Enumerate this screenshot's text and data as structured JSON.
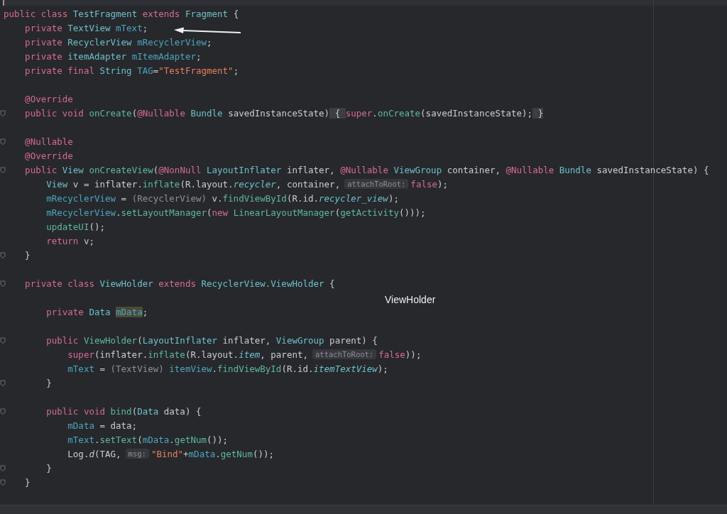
{
  "editor": {
    "lines": [
      {
        "fold": false,
        "segments": [
          {
            "kind": "code",
            "tokens": [
              {
                "text": "public class ",
                "kind": "kw"
              },
              {
                "text": "TestFragment ",
                "kind": "type"
              },
              {
                "text": "extends ",
                "kind": "kw"
              },
              {
                "text": "Fragment ",
                "kind": "type"
              },
              {
                "text": "{",
                "kind": "plain"
              }
            ]
          }
        ]
      },
      {
        "fold": false,
        "segments": [
          {
            "kind": "code",
            "tokens": [
              {
                "text": "    private ",
                "kind": "kw"
              },
              {
                "text": "TextView ",
                "kind": "type"
              },
              {
                "text": "mText",
                "kind": "field"
              },
              {
                "text": ";",
                "kind": "plain"
              }
            ]
          }
        ]
      },
      {
        "fold": false,
        "segments": [
          {
            "kind": "code",
            "tokens": [
              {
                "text": "    private ",
                "kind": "kw"
              },
              {
                "text": "RecyclerView ",
                "kind": "type"
              },
              {
                "text": "mRecyclerView",
                "kind": "field"
              },
              {
                "text": ";",
                "kind": "plain"
              }
            ]
          }
        ]
      },
      {
        "fold": false,
        "segments": [
          {
            "kind": "code",
            "tokens": [
              {
                "text": "    private ",
                "kind": "kw"
              },
              {
                "text": "itemAdapter ",
                "kind": "type"
              },
              {
                "text": "mItemAdapter",
                "kind": "field"
              },
              {
                "text": ";",
                "kind": "plain"
              }
            ]
          }
        ]
      },
      {
        "fold": false,
        "segments": [
          {
            "kind": "code",
            "tokens": [
              {
                "text": "    private final ",
                "kind": "kw"
              },
              {
                "text": "String ",
                "kind": "type"
              },
              {
                "text": "TAG",
                "kind": "field"
              },
              {
                "text": "=",
                "kind": "plain"
              },
              {
                "text": "\"TestFragment\"",
                "kind": "string"
              },
              {
                "text": ";",
                "kind": "plain"
              }
            ]
          }
        ]
      },
      {
        "fold": false
      },
      {
        "fold": false,
        "segments": [
          {
            "kind": "code",
            "tokens": [
              {
                "text": "    @Override",
                "kind": "annotation"
              }
            ]
          }
        ]
      },
      {
        "fold": true,
        "segments": [
          {
            "kind": "code",
            "tokens": [
              {
                "text": "    public void ",
                "kind": "kw"
              },
              {
                "text": "onCreate",
                "kind": "method"
              },
              {
                "text": "(",
                "kind": "plain"
              },
              {
                "text": "@Nullable ",
                "kind": "annotation"
              },
              {
                "text": "Bundle ",
                "kind": "type"
              },
              {
                "text": "savedInstanceState)",
                "kind": "plain"
              },
              {
                "text": " { ",
                "kind": "folded"
              },
              {
                "text": "super",
                "kind": "kw"
              },
              {
                "text": ".",
                "kind": "plain"
              },
              {
                "text": "onCreate",
                "kind": "method"
              },
              {
                "text": "(savedInstanceState);",
                "kind": "plain"
              },
              {
                "text": " }",
                "kind": "folded"
              }
            ]
          }
        ]
      },
      {
        "fold": false
      },
      {
        "fold": true,
        "segments": [
          {
            "kind": "code",
            "tokens": [
              {
                "text": "    @Nullable",
                "kind": "annotation"
              }
            ]
          }
        ]
      },
      {
        "fold": false,
        "segments": [
          {
            "kind": "code",
            "tokens": [
              {
                "text": "    @Override",
                "kind": "annotation"
              }
            ]
          }
        ]
      },
      {
        "fold": true,
        "segments": [
          {
            "kind": "code",
            "tokens": [
              {
                "text": "    public ",
                "kind": "kw"
              },
              {
                "text": "View ",
                "kind": "type"
              },
              {
                "text": "onCreateView",
                "kind": "method"
              },
              {
                "text": "(",
                "kind": "plain"
              },
              {
                "text": "@NonNull ",
                "kind": "annotation"
              },
              {
                "text": "LayoutInflater ",
                "kind": "type"
              },
              {
                "text": "inflater, ",
                "kind": "plain"
              },
              {
                "text": "@Nullable ",
                "kind": "annotation"
              },
              {
                "text": "ViewGroup ",
                "kind": "type"
              },
              {
                "text": "container, ",
                "kind": "plain"
              },
              {
                "text": "@Nullable ",
                "kind": "annotation"
              },
              {
                "text": "Bundle ",
                "kind": "type"
              },
              {
                "text": "savedInstanceState) {",
                "kind": "plain"
              }
            ]
          }
        ]
      },
      {
        "fold": false,
        "segments": [
          {
            "kind": "code",
            "tokens": [
              {
                "text": "        View ",
                "kind": "type"
              },
              {
                "text": "v = inflater.",
                "kind": "plain"
              },
              {
                "text": "inflate",
                "kind": "method"
              },
              {
                "text": "(R.layout.",
                "kind": "plain"
              },
              {
                "text": "recycler",
                "kind": "italic"
              },
              {
                "text": ", container,",
                "kind": "plain"
              }
            ]
          },
          {
            "kind": "hint",
            "text": "attachToRoot:"
          },
          {
            "kind": "code",
            "tokens": [
              {
                "text": "false",
                "kind": "kw"
              },
              {
                "text": ");",
                "kind": "plain"
              }
            ]
          }
        ]
      },
      {
        "fold": false,
        "segments": [
          {
            "kind": "code",
            "tokens": [
              {
                "text": "        mRecyclerView",
                "kind": "field"
              },
              {
                "text": " = ",
                "kind": "plain"
              },
              {
                "text": "(RecyclerView)",
                "kind": "cast"
              },
              {
                "text": " v.",
                "kind": "plain"
              },
              {
                "text": "findViewById",
                "kind": "method"
              },
              {
                "text": "(R.id.",
                "kind": "plain"
              },
              {
                "text": "recycler_view",
                "kind": "italic"
              },
              {
                "text": ");",
                "kind": "plain"
              }
            ]
          }
        ]
      },
      {
        "fold": false,
        "segments": [
          {
            "kind": "code",
            "tokens": [
              {
                "text": "        mRecyclerView",
                "kind": "field"
              },
              {
                "text": ".",
                "kind": "plain"
              },
              {
                "text": "setLayoutManager",
                "kind": "method"
              },
              {
                "text": "(",
                "kind": "plain"
              },
              {
                "text": "new ",
                "kind": "kw"
              },
              {
                "text": "LinearLayoutManager",
                "kind": "method"
              },
              {
                "text": "(",
                "kind": "plain"
              },
              {
                "text": "getActivity",
                "kind": "method"
              },
              {
                "text": "()));",
                "kind": "plain"
              }
            ]
          }
        ]
      },
      {
        "fold": false,
        "segments": [
          {
            "kind": "code",
            "tokens": [
              {
                "text": "        updateUI",
                "kind": "method"
              },
              {
                "text": "();",
                "kind": "plain"
              }
            ]
          }
        ]
      },
      {
        "fold": false,
        "segments": [
          {
            "kind": "code",
            "tokens": [
              {
                "text": "        return ",
                "kind": "kw"
              },
              {
                "text": "v;",
                "kind": "plain"
              }
            ]
          }
        ]
      },
      {
        "fold": true,
        "segments": [
          {
            "kind": "code",
            "tokens": [
              {
                "text": "    }",
                "kind": "plain"
              }
            ]
          }
        ]
      },
      {
        "fold": false
      },
      {
        "fold": true,
        "segments": [
          {
            "kind": "code",
            "tokens": [
              {
                "text": "    private class ",
                "kind": "kw"
              },
              {
                "text": "ViewHolder ",
                "kind": "type"
              },
              {
                "text": "extends ",
                "kind": "kw"
              },
              {
                "text": "RecyclerView.ViewHolder ",
                "kind": "type"
              },
              {
                "text": "{",
                "kind": "plain"
              }
            ]
          }
        ]
      },
      {
        "fold": false
      },
      {
        "fold": false,
        "segments": [
          {
            "kind": "code",
            "tokens": [
              {
                "text": "        private ",
                "kind": "kw"
              },
              {
                "text": "Data ",
                "kind": "type"
              },
              {
                "text": "mData",
                "kind": "highlight"
              },
              {
                "text": ";",
                "kind": "plain"
              }
            ]
          }
        ]
      },
      {
        "fold": false
      },
      {
        "fold": true,
        "segments": [
          {
            "kind": "code",
            "tokens": [
              {
                "text": "        public ",
                "kind": "kw"
              },
              {
                "text": "ViewHolder",
                "kind": "method"
              },
              {
                "text": "(",
                "kind": "plain"
              },
              {
                "text": "LayoutInflater ",
                "kind": "type"
              },
              {
                "text": "inflater, ",
                "kind": "plain"
              },
              {
                "text": "ViewGroup ",
                "kind": "type"
              },
              {
                "text": "parent) {",
                "kind": "plain"
              }
            ]
          }
        ]
      },
      {
        "fold": false,
        "segments": [
          {
            "kind": "code",
            "tokens": [
              {
                "text": "            super",
                "kind": "kw"
              },
              {
                "text": "(inflater.",
                "kind": "plain"
              },
              {
                "text": "inflate",
                "kind": "method"
              },
              {
                "text": "(R.layout.",
                "kind": "plain"
              },
              {
                "text": "item",
                "kind": "italic"
              },
              {
                "text": ", parent,",
                "kind": "plain"
              }
            ]
          },
          {
            "kind": "hint",
            "text": "attachToRoot:"
          },
          {
            "kind": "code",
            "tokens": [
              {
                "text": "false",
                "kind": "kw"
              },
              {
                "text": "));",
                "kind": "plain"
              }
            ]
          }
        ]
      },
      {
        "fold": false,
        "segments": [
          {
            "kind": "code",
            "tokens": [
              {
                "text": "            mText",
                "kind": "field"
              },
              {
                "text": " = ",
                "kind": "plain"
              },
              {
                "text": "(TextView) ",
                "kind": "cast"
              },
              {
                "text": "itemView",
                "kind": "field"
              },
              {
                "text": ".",
                "kind": "plain"
              },
              {
                "text": "findViewById",
                "kind": "method"
              },
              {
                "text": "(R.id.",
                "kind": "plain"
              },
              {
                "text": "itemTextView",
                "kind": "italic"
              },
              {
                "text": ");",
                "kind": "plain"
              }
            ]
          }
        ]
      },
      {
        "fold": true,
        "segments": [
          {
            "kind": "code",
            "tokens": [
              {
                "text": "        }",
                "kind": "plain"
              }
            ]
          }
        ]
      },
      {
        "fold": false
      },
      {
        "fold": true,
        "segments": [
          {
            "kind": "code",
            "tokens": [
              {
                "text": "        public void ",
                "kind": "kw"
              },
              {
                "text": "bind",
                "kind": "method"
              },
              {
                "text": "(",
                "kind": "plain"
              },
              {
                "text": "Data ",
                "kind": "type"
              },
              {
                "text": "data) {",
                "kind": "plain"
              }
            ]
          }
        ]
      },
      {
        "fold": false,
        "segments": [
          {
            "kind": "code",
            "tokens": [
              {
                "text": "            mData",
                "kind": "field"
              },
              {
                "text": " = data;",
                "kind": "plain"
              }
            ]
          }
        ]
      },
      {
        "fold": false,
        "segments": [
          {
            "kind": "code",
            "tokens": [
              {
                "text": "            mText",
                "kind": "field"
              },
              {
                "text": ".",
                "kind": "plain"
              },
              {
                "text": "setText",
                "kind": "method"
              },
              {
                "text": "(",
                "kind": "plain"
              },
              {
                "text": "mData",
                "kind": "field"
              },
              {
                "text": ".",
                "kind": "plain"
              },
              {
                "text": "getNum",
                "kind": "method"
              },
              {
                "text": "());",
                "kind": "plain"
              }
            ]
          }
        ]
      },
      {
        "fold": false,
        "segments": [
          {
            "kind": "code",
            "tokens": [
              {
                "text": "            Log.",
                "kind": "plain"
              },
              {
                "text": "d",
                "kind": "italicplain"
              },
              {
                "text": "(TAG,",
                "kind": "plain"
              }
            ]
          },
          {
            "kind": "hint",
            "text": "msg:"
          },
          {
            "kind": "code",
            "tokens": [
              {
                "text": "\"Bind\"",
                "kind": "string"
              },
              {
                "text": "+",
                "kind": "plain"
              },
              {
                "text": "mData",
                "kind": "field"
              },
              {
                "text": ".",
                "kind": "plain"
              },
              {
                "text": "getNum",
                "kind": "method"
              },
              {
                "text": "());",
                "kind": "plain"
              }
            ]
          }
        ]
      },
      {
        "fold": true,
        "segments": [
          {
            "kind": "code",
            "tokens": [
              {
                "text": "        }",
                "kind": "plain"
              }
            ]
          }
        ]
      },
      {
        "fold": true,
        "segments": [
          {
            "kind": "code",
            "tokens": [
              {
                "text": "    }",
                "kind": "plain"
              }
            ]
          }
        ]
      }
    ]
  },
  "popup_label": "ViewHolder"
}
